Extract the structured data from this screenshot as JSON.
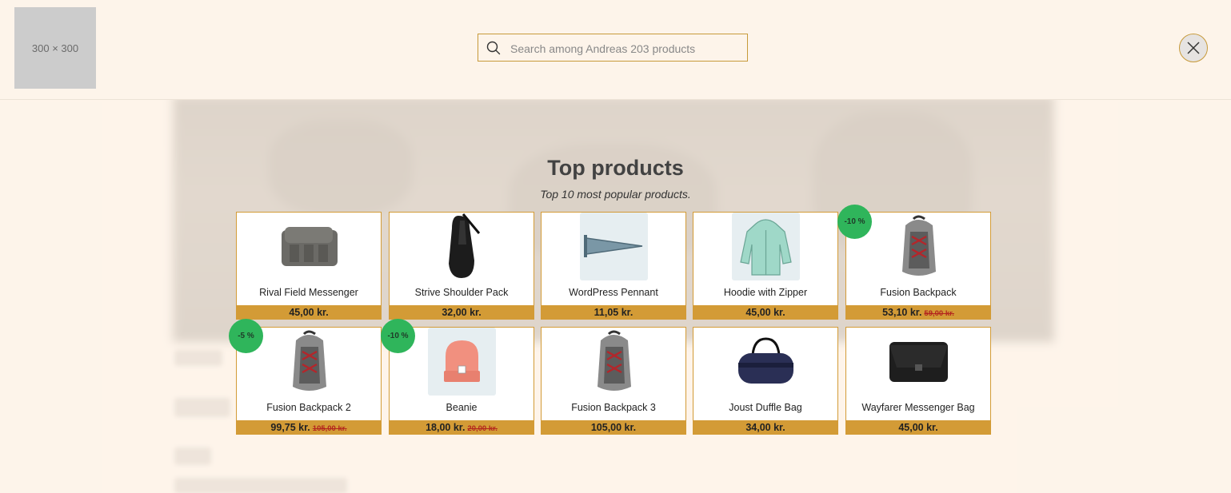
{
  "header": {
    "logo_text": "300 × 300",
    "search_placeholder": "Search among Andreas 203 products",
    "search_icon": "search-icon",
    "close_icon": "close-icon"
  },
  "section": {
    "title": "Top products",
    "subtitle": "Top 10 most popular products."
  },
  "colors": {
    "accent": "#d39b36",
    "discount_badge": "#2fb55b",
    "background": "#fdf4ea"
  },
  "products": [
    {
      "name": "Rival Field Messenger",
      "price": "45,00 kr.",
      "old_price": "",
      "badge": ""
    },
    {
      "name": "Strive Shoulder Pack",
      "price": "32,00 kr.",
      "old_price": "",
      "badge": ""
    },
    {
      "name": "WordPress Pennant",
      "price": "11,05 kr.",
      "old_price": "",
      "badge": ""
    },
    {
      "name": "Hoodie with Zipper",
      "price": "45,00 kr.",
      "old_price": "",
      "badge": ""
    },
    {
      "name": "Fusion Backpack",
      "price": "53,10 kr.",
      "old_price": "59,00 kr.",
      "badge": "-10 %"
    },
    {
      "name": "Fusion Backpack 2",
      "price": "99,75 kr.",
      "old_price": "105,00 kr.",
      "badge": "-5 %"
    },
    {
      "name": "Beanie",
      "price": "18,00 kr.",
      "old_price": "20,00 kr.",
      "badge": "-10 %"
    },
    {
      "name": "Fusion Backpack 3",
      "price": "105,00 kr.",
      "old_price": "",
      "badge": ""
    },
    {
      "name": "Joust Duffle Bag",
      "price": "34,00 kr.",
      "old_price": "",
      "badge": ""
    },
    {
      "name": "Wayfarer Messenger Bag",
      "price": "45,00 kr.",
      "old_price": "",
      "badge": ""
    }
  ]
}
